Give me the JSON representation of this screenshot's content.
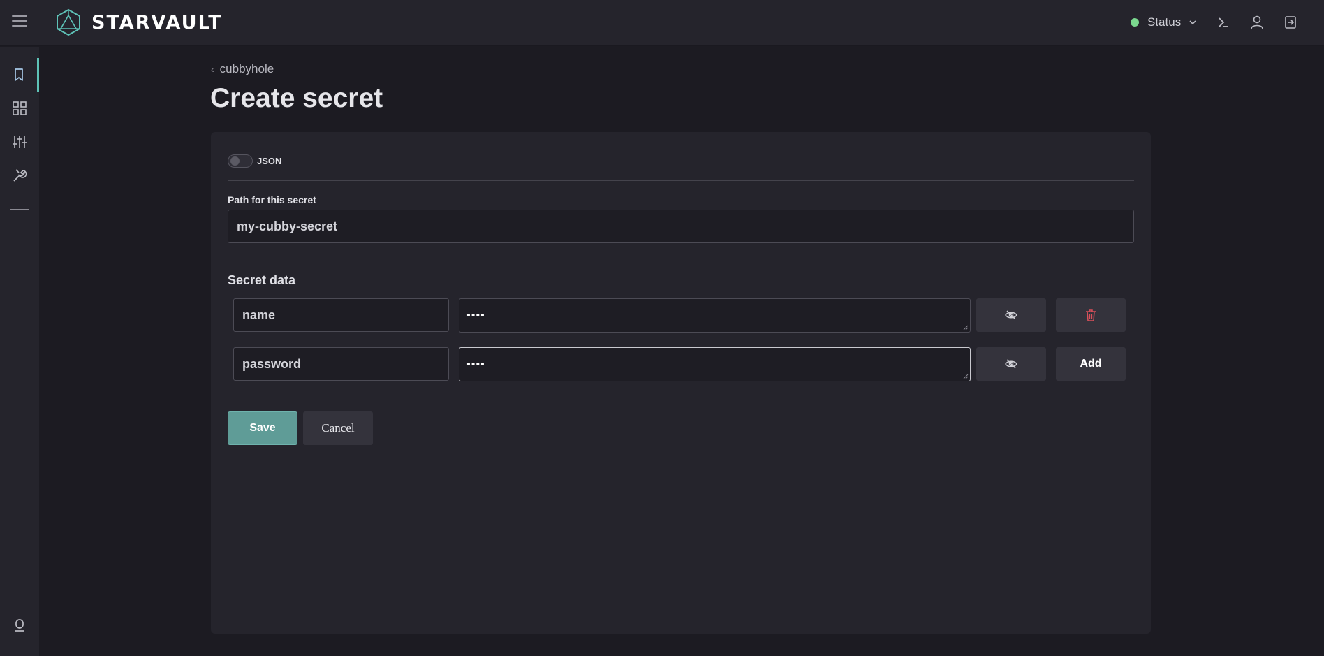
{
  "app": {
    "brand": "STARVAULT",
    "status_label": "Status",
    "status_color": "#7bd88f",
    "accent_color": "#5ec2b7",
    "primary_button_color": "#5f9c97"
  },
  "topbar": {
    "icons": [
      "menu-icon",
      "terminal-icon",
      "user-icon",
      "logout-icon"
    ]
  },
  "sidebar": {
    "items": [
      {
        "icon": "bookmark-icon",
        "active": true
      },
      {
        "icon": "grid-icon",
        "active": false
      },
      {
        "icon": "sliders-icon",
        "active": false
      },
      {
        "icon": "tools-icon",
        "active": false
      }
    ],
    "footer_icon": "info-icon"
  },
  "breadcrumb": {
    "label": "cubbyhole"
  },
  "page": {
    "title": "Create secret"
  },
  "form": {
    "json_toggle_label": "JSON",
    "json_toggle_on": false,
    "path_label": "Path for this secret",
    "path_value": "my-cubby-secret",
    "secret_data_label": "Secret data",
    "rows": [
      {
        "key": "name",
        "value": "▪▪▪▪",
        "action": "delete"
      },
      {
        "key": "password",
        "value": "▪▪▪▪",
        "action": "Add"
      }
    ],
    "save_label": "Save",
    "cancel_label": "Cancel"
  }
}
